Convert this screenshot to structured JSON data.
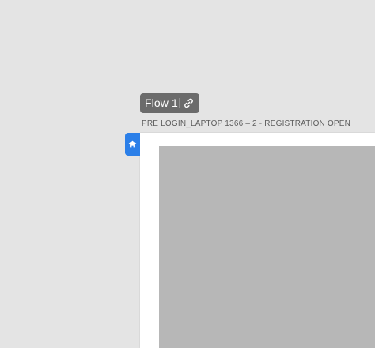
{
  "flow": {
    "label": "Flow 1",
    "link_icon": "link-icon"
  },
  "artboard": {
    "title": "PRE LOGIN_LAPTOP 1366 – 2 - REGISTRATION OPEN",
    "home_icon": "home-icon"
  },
  "colors": {
    "canvas": "#e4e4e4",
    "pill": "#6b6b6b",
    "accent": "#2b7fe8",
    "placeholder": "#b7b7b7"
  }
}
